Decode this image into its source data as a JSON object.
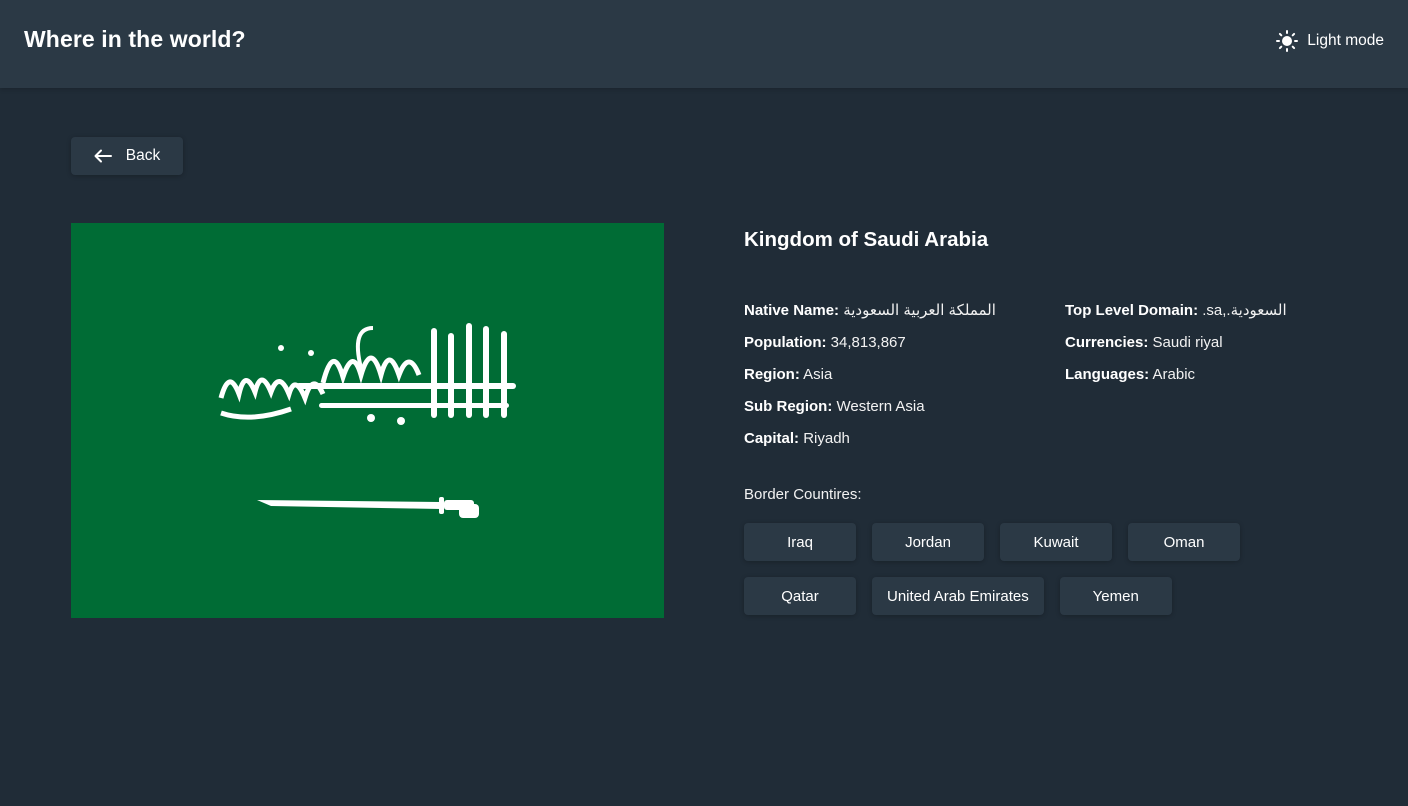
{
  "header": {
    "title": "Where in the world?",
    "theme_toggle": {
      "label": "Light mode",
      "icon": "sun-icon"
    }
  },
  "back_button": {
    "label": "Back",
    "icon": "arrow-left-icon"
  },
  "flag": {
    "colors": {
      "field": "#006c35",
      "emblem": "#ffffff"
    },
    "alt": "Saudi Arabia flag"
  },
  "country": {
    "name": "Kingdom of Saudi Arabia",
    "details_left": [
      {
        "key": "Native Name:",
        "value": "المملكة العربية السعودية"
      },
      {
        "key": "Population:",
        "value": "34,813,867"
      },
      {
        "key": "Region:",
        "value": "Asia"
      },
      {
        "key": "Sub Region:",
        "value": "Western Asia"
      },
      {
        "key": "Capital:",
        "value": "Riyadh"
      }
    ],
    "details_right": [
      {
        "key": "Top Level Domain:",
        "value": ".sa,.السعودية"
      },
      {
        "key": "Currencies:",
        "value": "Saudi riyal"
      },
      {
        "key": "Languages:",
        "value": "Arabic"
      }
    ],
    "border_label": "Border Countires:",
    "border_countries": [
      "Iraq",
      "Jordan",
      "Kuwait",
      "Oman",
      "Qatar",
      "United Arab Emirates",
      "Yemen"
    ]
  },
  "colors": {
    "background": "#202c37",
    "elements": "#2b3945",
    "text": "#ffffff"
  }
}
